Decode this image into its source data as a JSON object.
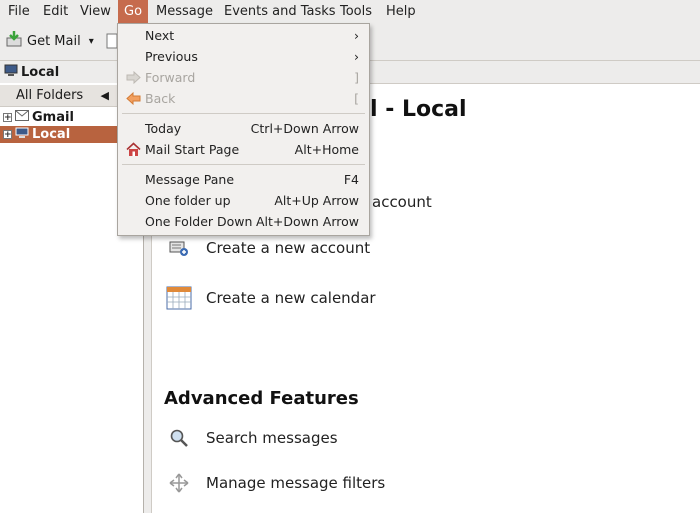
{
  "menubar": {
    "items": [
      {
        "label": "File"
      },
      {
        "label": "Edit"
      },
      {
        "label": "View"
      },
      {
        "label": "Go"
      },
      {
        "label": "Message"
      },
      {
        "label": "Events and Tasks"
      },
      {
        "label": "Tools"
      },
      {
        "label": "Help"
      }
    ],
    "active_color": "#c66b4d"
  },
  "toolbar": {
    "get_mail_label": "Get Mail"
  },
  "sidebar": {
    "header_label": "Local",
    "view_label": "All Folders",
    "folders": [
      {
        "label": "Gmail"
      },
      {
        "label": "Local"
      }
    ]
  },
  "main": {
    "title_suffix": "l - Local",
    "items": [
      {
        "label": "account"
      },
      {
        "label": "Create a new account"
      },
      {
        "label": "Create a new calendar"
      }
    ],
    "advanced_heading": "Advanced Features",
    "advanced_items": [
      {
        "label": "Search messages"
      },
      {
        "label": "Manage message filters"
      }
    ]
  },
  "go_menu": {
    "items": [
      {
        "label": "Next",
        "shortcut": "›",
        "disabled": false
      },
      {
        "label": "Previous",
        "shortcut": "›",
        "disabled": false
      },
      {
        "label": "Forward",
        "shortcut": "]",
        "disabled": true
      },
      {
        "label": "Back",
        "shortcut": "[",
        "disabled": true
      },
      {
        "label": "Today",
        "shortcut": "Ctrl+Down Arrow",
        "disabled": false
      },
      {
        "label": "Mail Start Page",
        "shortcut": "Alt+Home",
        "disabled": false
      },
      {
        "label": "Message Pane",
        "shortcut": "F4",
        "disabled": false
      },
      {
        "label": "One folder up",
        "shortcut": "Alt+Up Arrow",
        "disabled": false
      },
      {
        "label": "One Folder Down",
        "shortcut": "Alt+Down Arrow",
        "disabled": false
      }
    ]
  },
  "colors": {
    "selection": "#b8633f",
    "background": "#edeceb"
  }
}
